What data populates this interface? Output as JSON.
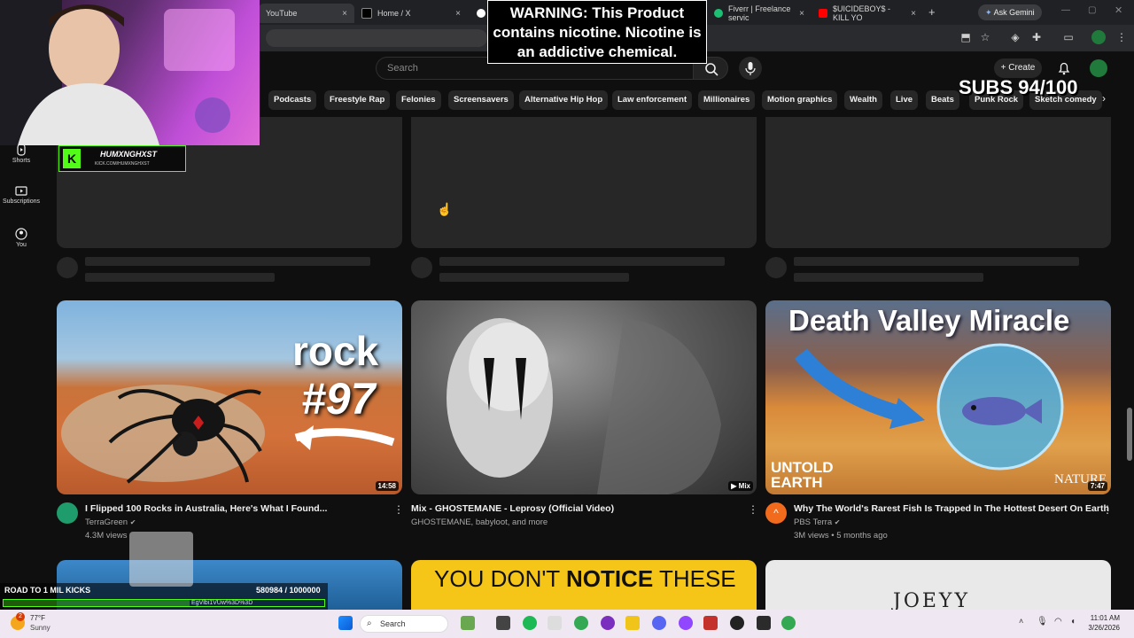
{
  "tabs": [
    {
      "label": "YouTube",
      "close": "×"
    },
    {
      "label": "Home / X",
      "close": "×"
    },
    {
      "label": "Fiverr | Freelance servic",
      "close": "×"
    },
    {
      "label": "$UICIDEBOY$ - KILL YO",
      "close": "×"
    }
  ],
  "new_tab": "+",
  "ask_gemini": "Ask Gemini",
  "header": {
    "search_placeholder": "Search",
    "create_label": "Create"
  },
  "chips": [
    "Podcasts",
    "Freestyle Rap",
    "Felonies",
    "Screensavers",
    "Alternative Hip Hop",
    "Law enforcement",
    "Millionaires",
    "Motion graphics",
    "Wealth",
    "Live",
    "Beats",
    "Punk Rock",
    "Sketch comedy"
  ],
  "sidebar": {
    "items": [
      {
        "label": "Shorts"
      },
      {
        "label": "Subscriptions"
      },
      {
        "label": "You"
      }
    ]
  },
  "videos": [
    {
      "title": "I Flipped 100 Rocks in Australia, Here's What I Found...",
      "channel": "TerraGreen",
      "meta": "4.3M views",
      "duration": "14:58",
      "thumb_text_1": "rock",
      "thumb_text_2": "#97",
      "avatar_color": "#1f9c6b"
    },
    {
      "title": "Mix - GHOSTEMANE - Leprosy (Official Video)",
      "channel": "GHOSTEMANE, babyloot, and more",
      "meta": "",
      "duration": "Mix",
      "avatar_color": ""
    },
    {
      "title": "Why The World's Rarest Fish Is Trapped In The Hottest Desert On Earth",
      "channel": "PBS Terra",
      "meta": "3M views • 5 months ago",
      "duration": "7:47",
      "thumb_headline": "Death Valley Miracle",
      "thumb_brand_1": "UNTOLD",
      "thumb_brand_2": "EARTH",
      "thumb_brand_3": "NATURE",
      "avatar_color": "#f26b1d"
    }
  ],
  "second_row": {
    "card2_text_1": "YOU DON'T ",
    "card2_text_2": "NOTICE",
    "card2_text_3": " THESE",
    "card3_text": "JOEYY"
  },
  "overlays": {
    "warning_text": "WARNING: This Product contains nicotine. Nicotine is an addictive chemical.",
    "subs_text": "SUBS 94/100",
    "kick_name": "HUMXNGHXST",
    "kick_sub": "KICK.COM/HUMXNGHXST",
    "road_label": "ROAD TO 1 MIL KICKS",
    "road_count": "580984 / 1000000",
    "road_url": "EgVlbi1VUw%3D%3D"
  },
  "taskbar": {
    "weather_temp": "77°F",
    "weather_cond": "Sunny",
    "search_label": "Search",
    "time": "11:01 AM",
    "date": "3/26/2026",
    "badge_count": "2"
  },
  "colors": {
    "yt_bg": "#0f0f0f",
    "chip_bg": "#272727",
    "kick_green": "#53fc18"
  }
}
